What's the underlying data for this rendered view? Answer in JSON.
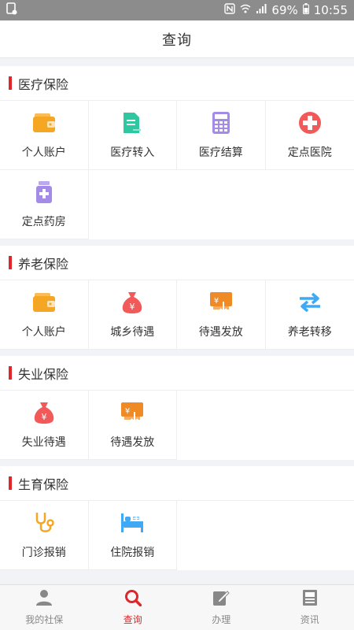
{
  "status": {
    "battery": "69%",
    "time": "10:55"
  },
  "header": {
    "title": "查询"
  },
  "sections": [
    {
      "title": "医疗保险",
      "items": [
        {
          "label": "个人账户",
          "icon": "wallet-icon",
          "color": "#f5a623"
        },
        {
          "label": "医疗转入",
          "icon": "document-transfer-icon",
          "color": "#2ec7a0"
        },
        {
          "label": "医疗结算",
          "icon": "calculator-icon",
          "color": "#a58be8"
        },
        {
          "label": "定点医院",
          "icon": "hospital-cross-icon",
          "color": "#f25a5a"
        },
        {
          "label": "定点药房",
          "icon": "medicine-bottle-icon",
          "color": "#a58be8"
        }
      ]
    },
    {
      "title": "养老保险",
      "items": [
        {
          "label": "个人账户",
          "icon": "wallet-icon",
          "color": "#f5a623"
        },
        {
          "label": "城乡待遇",
          "icon": "money-bag-icon",
          "color": "#f25a5a"
        },
        {
          "label": "待遇发放",
          "icon": "payout-card-icon",
          "color": "#f08a24"
        },
        {
          "label": "养老转移",
          "icon": "transfer-arrows-icon",
          "color": "#3fa9f5"
        }
      ]
    },
    {
      "title": "失业保险",
      "items": [
        {
          "label": "失业待遇",
          "icon": "money-bag-icon",
          "color": "#f25a5a"
        },
        {
          "label": "待遇发放",
          "icon": "payout-card-icon",
          "color": "#f08a24"
        }
      ]
    },
    {
      "title": "生育保险",
      "items": [
        {
          "label": "门诊报销",
          "icon": "stethoscope-icon",
          "color": "#f5a623"
        },
        {
          "label": "住院报销",
          "icon": "hospital-bed-icon",
          "color": "#3fa9f5"
        }
      ]
    }
  ],
  "tabs": [
    {
      "label": "我的社保",
      "icon": "person-icon",
      "active": false
    },
    {
      "label": "查询",
      "icon": "search-icon",
      "active": true
    },
    {
      "label": "办理",
      "icon": "edit-icon",
      "active": false
    },
    {
      "label": "资讯",
      "icon": "news-icon",
      "active": false
    }
  ],
  "colors": {
    "accent": "#e0262b",
    "inactive": "#888888"
  }
}
